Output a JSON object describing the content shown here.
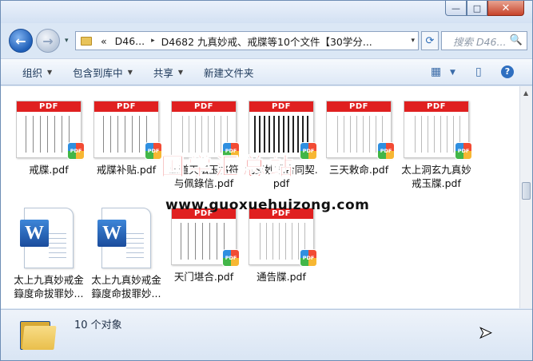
{
  "window": {
    "min_label": "—",
    "max_label": "□",
    "close_label": "✕"
  },
  "nav": {
    "back_icon": "←",
    "forward_icon": "→",
    "dropdown": "▾"
  },
  "address": {
    "crumbs": [
      "«",
      "D46...",
      "D4682 九真妙戒、戒牒等10个文件【30学分..."
    ],
    "separator": "▸",
    "dropdown": "▾"
  },
  "refresh_icon": "⟳",
  "search": {
    "placeholder": "搜索 D46...",
    "icon": "🔍"
  },
  "toolbar": {
    "organize": "组织",
    "include": "包含到库中",
    "share": "共享",
    "new_folder": "新建文件夹",
    "arrow": "▼",
    "view_icon": "▦",
    "pane_icon": "▯",
    "help_icon": "?"
  },
  "files": [
    {
      "name": "戒牒.pdf",
      "type": "pdf"
    },
    {
      "name": "戒牒补贴.pdf",
      "type": "pdf"
    },
    {
      "name": "高道天坛玉格符与佩錄信.pdf",
      "type": "pdf"
    },
    {
      "name": "九真妙戒合同契.pdf",
      "type": "pdf"
    },
    {
      "name": "三天敕命.pdf",
      "type": "pdf"
    },
    {
      "name": "太上洞玄九真妙戒玉牒.pdf",
      "type": "pdf"
    },
    {
      "name": "太上九真妙戒金籙度命拔罪妙...",
      "type": "doc"
    },
    {
      "name": "太上九真妙戒金籙度命拔罪妙...",
      "type": "doc"
    },
    {
      "name": "天门堪合.pdf",
      "type": "pdf"
    },
    {
      "name": "通告牒.pdf",
      "type": "pdf"
    }
  ],
  "pdf_label": "PDF",
  "pdf_badge": "PDF",
  "word_letter": "W",
  "watermark": {
    "title": "国学汇总站",
    "url": "www.guoxuehuizong.com"
  },
  "status": {
    "count": "10 个对象"
  }
}
